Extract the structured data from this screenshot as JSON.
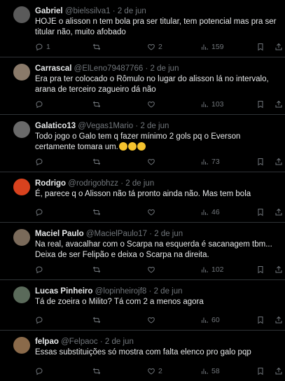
{
  "tweets": [
    {
      "name": "Gabriel",
      "handle": "@bielssilva1",
      "date": "2 de jun",
      "text": "HOJE o alisson n tem bola pra ser titular, tem potencial mas pra ser titular não, muito afobado",
      "replies": "1",
      "retweets": "",
      "likes": "2",
      "views": "159",
      "avatar_color": "#5a5a5a"
    },
    {
      "name": "Carrascal",
      "handle": "@ElLeno79487766",
      "date": "2 de jun",
      "text": "Era pra ter colocado o Rômulo no lugar do alisson lá no intervalo, arana de terceiro zagueiro dá não",
      "replies": "",
      "retweets": "",
      "likes": "",
      "views": "103",
      "avatar_color": "#8a7a6a"
    },
    {
      "name": "Galatico13",
      "handle": "@Vegas1Mario",
      "date": "2 de jun",
      "text": "Todo jogo o Galo tem q fazer mínimo 2 gols pq o Everson certamente tomara um.",
      "emoji_count": "3",
      "replies": "",
      "retweets": "",
      "likes": "",
      "views": "73",
      "avatar_color": "#6a6a6a"
    },
    {
      "name": "Rodrigo",
      "handle": "@rodrigobhzz",
      "date": "2 de jun",
      "text": "É, parece q o Alisson não tá pronto ainda não. Mas tem bola",
      "replies": "",
      "retweets": "",
      "likes": "",
      "views": "46",
      "avatar_color": "#d8421e"
    },
    {
      "name": "Maciel Paulo",
      "handle": "@MacielPaulo17",
      "date": "2 de jun",
      "text": "Na real, avacalhar com o Scarpa na esquerda é sacanagem tbm... Deixa de ser Felipão e deixa o Scarpa na direita.",
      "replies": "",
      "retweets": "",
      "likes": "",
      "views": "102",
      "avatar_color": "#7a6a5a"
    },
    {
      "name": "Lucas Pinheiro",
      "handle": "@lopinheirojf8",
      "date": "2 de jun",
      "text": "Tá de zoeira o Milito? Tá com 2 a menos agora",
      "replies": "",
      "retweets": "",
      "likes": "",
      "views": "60",
      "avatar_color": "#5a6a5a"
    },
    {
      "name": "felpao",
      "handle": "@Felpaoc",
      "date": "2 de jun",
      "text": "Essas substituições só mostra com falta elenco pro galo pqp",
      "replies": "",
      "retweets": "",
      "likes": "2",
      "views": "58",
      "avatar_color": "#8a6a4a"
    }
  ],
  "separator": "·"
}
